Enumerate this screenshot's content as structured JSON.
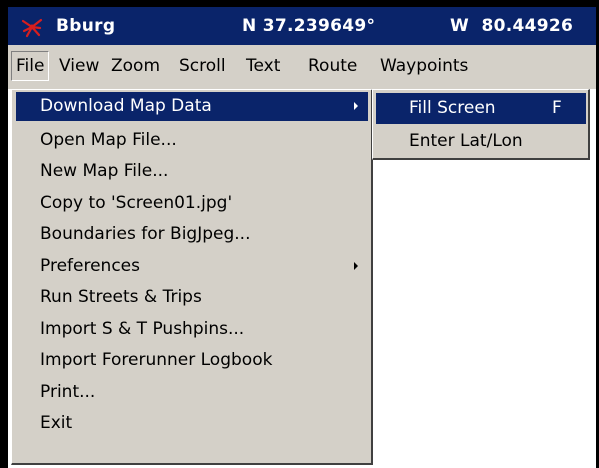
{
  "window": {
    "title": "Bburg",
    "latitude": "N 37.239649°",
    "longitude": "W  80.44926",
    "icon": "map-pin-app-icon"
  },
  "menubar": {
    "items": [
      "File",
      "View",
      "Zoom",
      "Scroll",
      "Text",
      "Route",
      "Waypoints"
    ],
    "active": "File"
  },
  "file_menu": {
    "items": [
      {
        "label": "Download Map Data",
        "has_submenu": true,
        "highlighted": true
      },
      {
        "label": "Open Map File..."
      },
      {
        "label": "New Map File..."
      },
      {
        "label": "Copy to 'Screen01.jpg'"
      },
      {
        "label": "Boundaries for BigJpeg..."
      },
      {
        "label": "Preferences",
        "has_submenu": true
      },
      {
        "label": "Run Streets & Trips"
      },
      {
        "label": "Import S & T Pushpins..."
      },
      {
        "label": "Import Forerunner Logbook"
      },
      {
        "label": "Print..."
      },
      {
        "label": "Exit"
      }
    ]
  },
  "download_submenu": {
    "items": [
      {
        "label": "Fill Screen",
        "accelerator": "F",
        "highlighted": true
      },
      {
        "label": "Enter Lat/Lon"
      }
    ]
  },
  "colors": {
    "highlight": "#0a246a",
    "menu_face": "#d4d0c8",
    "titlebar": "#0a246a",
    "frame": "#000000"
  }
}
